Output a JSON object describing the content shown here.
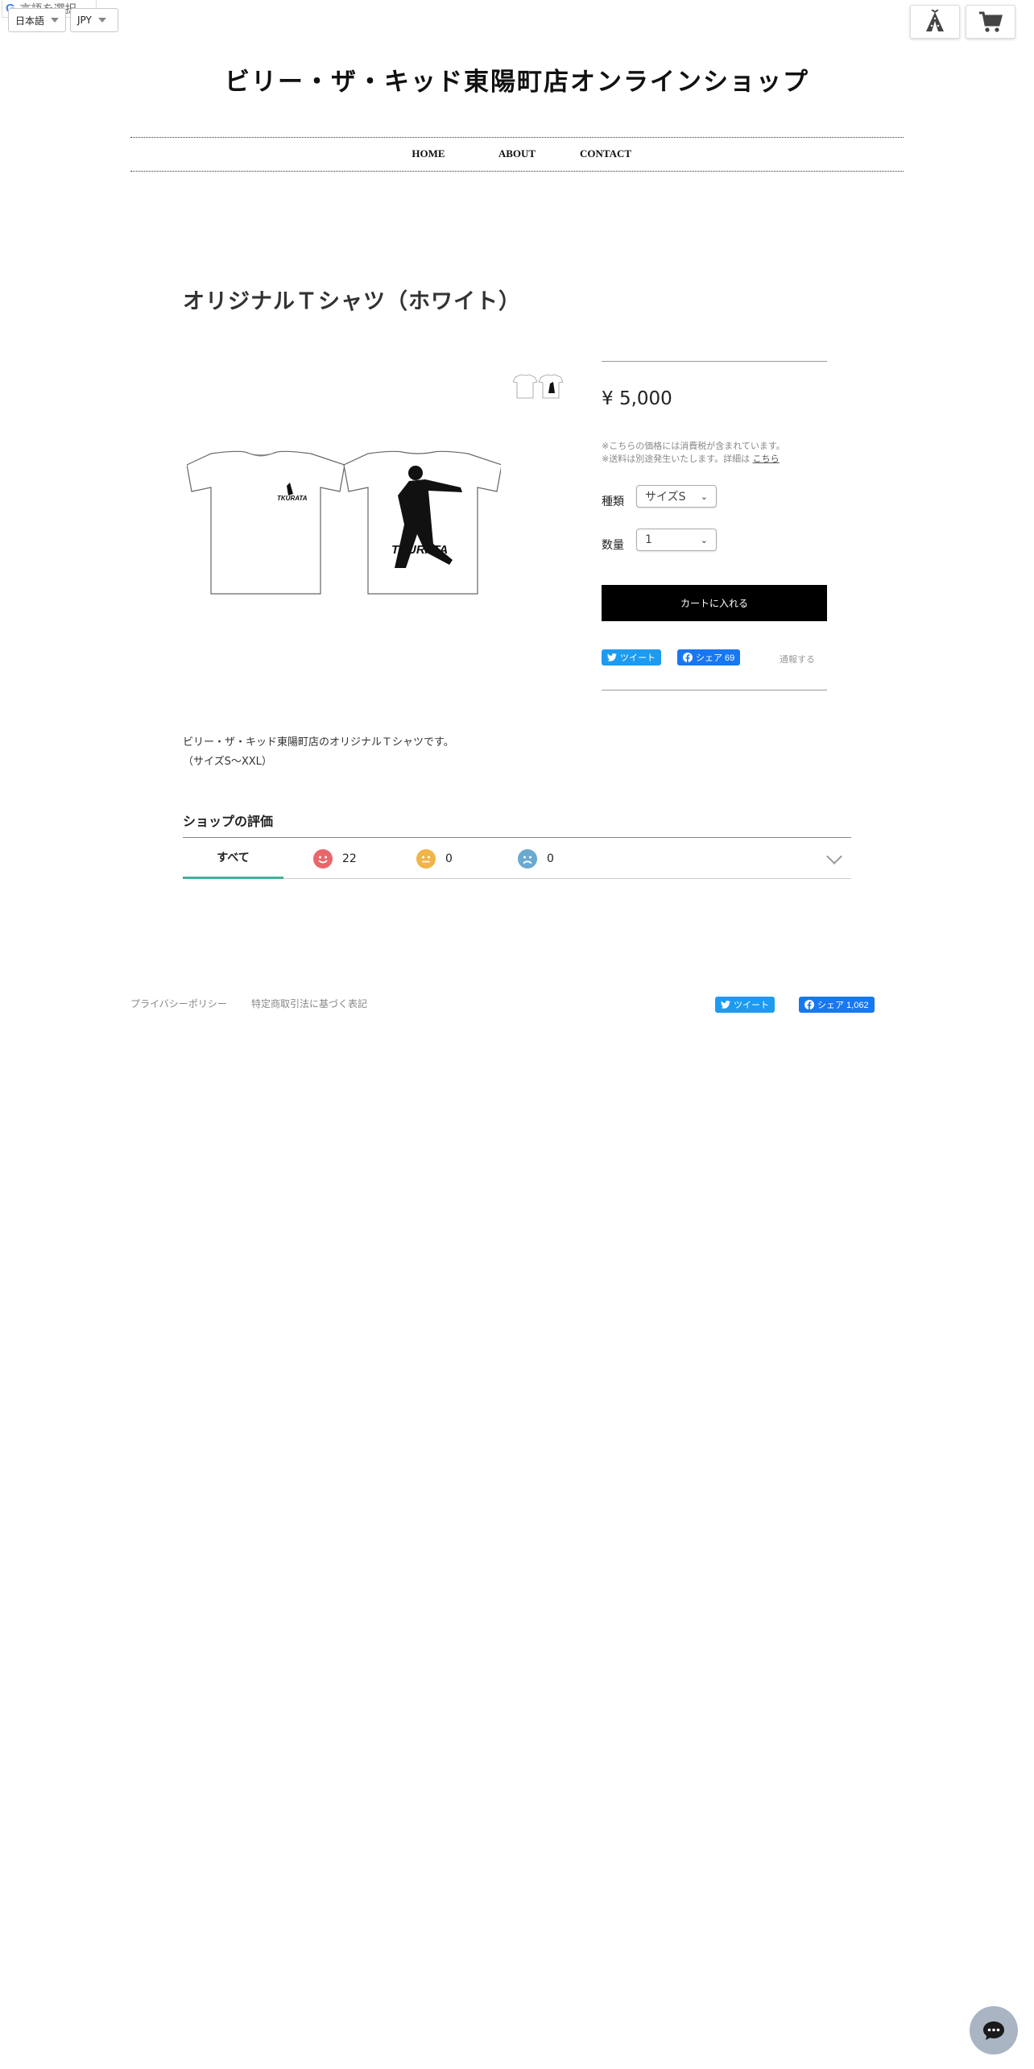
{
  "topbar": {
    "translate_badge": "言語を選択",
    "language": "日本語",
    "currency": "JPY"
  },
  "header": {
    "shop_title": "ビリー・ザ・キッド東陽町店オンラインショップ",
    "nav": [
      "HOME",
      "ABOUT",
      "CONTACT"
    ]
  },
  "product": {
    "title": "オリジナルＴシャツ（ホワイト）",
    "price": "¥ 5,000",
    "tax_note_1": "※こちらの価格には消費税が含まれています。",
    "tax_note_2": "※送料は別途発生いたします。詳細は",
    "tax_link": "こちら",
    "option_label": "種類",
    "option_value": "サイズS",
    "qty_label": "数量",
    "qty_value": "1",
    "cart_button": "カートに入れる",
    "tweet": "ツイート",
    "share": "シェア 69",
    "notify": "通報する",
    "shirt_print": "TKURATA",
    "description_1": "ビリー・ザ・キッド東陽町店のオリジナルＴシャツです。",
    "description_2": "（サイズS～XXL）"
  },
  "reviews": {
    "title": "ショップの評価",
    "all_tab": "すべて",
    "good_count": "22",
    "neutral_count": "0",
    "bad_count": "0"
  },
  "footer": {
    "privacy": "プライバシーポリシー",
    "legal": "特定商取引法に基づく表記",
    "tweet": "ツイート",
    "share": "シェア 1,062"
  },
  "colors": {
    "accent_tab": "#3cb39a",
    "twitter": "#1d9bf0",
    "facebook": "#1877f2",
    "face_good": "#e9676a",
    "face_neutral": "#f0b447",
    "face_bad": "#6aa9d0"
  }
}
